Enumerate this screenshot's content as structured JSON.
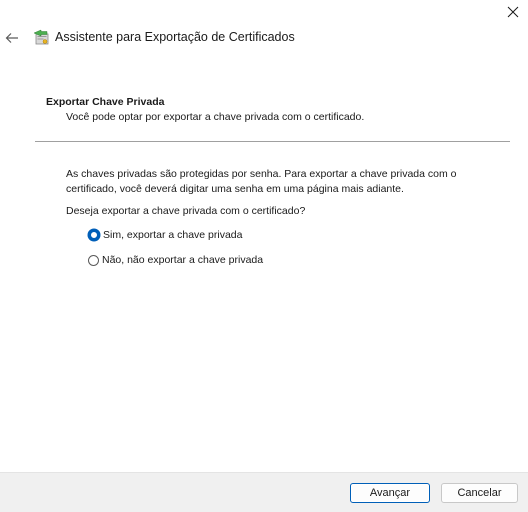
{
  "window": {
    "title": "Assistente para Exportação de Certificados"
  },
  "section": {
    "title": "Exportar Chave Privada",
    "subtitle": "Você pode optar por exportar a chave privada com o certificado."
  },
  "body": {
    "description": "As chaves privadas são protegidas por senha. Para exportar a chave privada com o certificado, você deverá digitar uma senha em uma página mais adiante.",
    "question": "Deseja exportar a chave privada com o certificado?"
  },
  "options": [
    {
      "label": "Sim, exportar a chave privada",
      "checked": true
    },
    {
      "label": "Não, não exportar a chave privada",
      "checked": false
    }
  ],
  "footer": {
    "next_label": "Avançar",
    "cancel_label": "Cancelar"
  },
  "colors": {
    "accent": "#005fb8",
    "footer_bg": "#f0f0f0"
  },
  "icons": [
    "close-icon",
    "back-arrow-icon",
    "certificate-wizard-icon"
  ]
}
